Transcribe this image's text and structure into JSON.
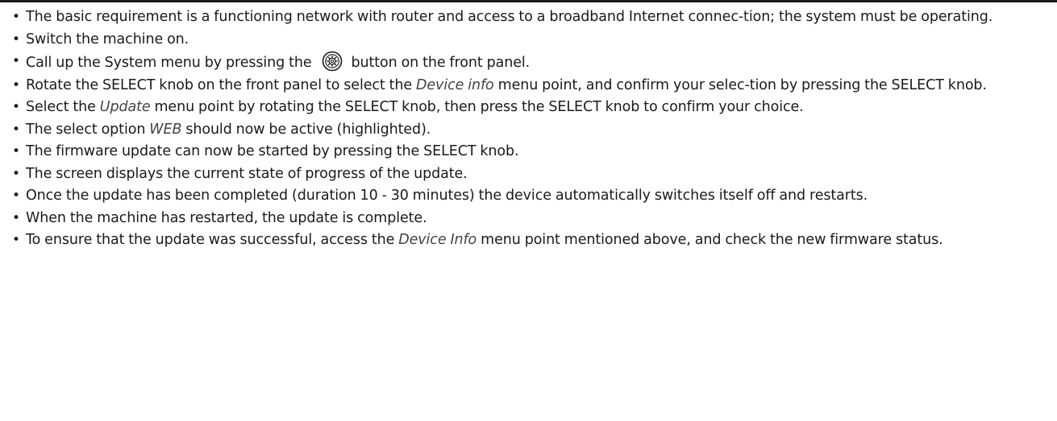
{
  "instructions": {
    "items": [
      {
        "text": "The basic requirement is a functioning network with router and access to a broadband Internet connec-tion; the system must be operating."
      },
      {
        "text": "Switch the machine on."
      },
      {
        "before": "Call up the System menu by pressing the",
        "icon": "system-menu-button-icon",
        "after": "button on the front panel."
      },
      {
        "before": "Rotate the SELECT knob on the front panel to select the ",
        "term": "Device info",
        "after": " menu point, and confirm your selec-tion by pressing the SELECT knob."
      },
      {
        "before": "Select the ",
        "term": "Update",
        "after": " menu point by rotating the SELECT knob, then press the SELECT knob to confirm your choice."
      },
      {
        "before": "The select option ",
        "term": "WEB",
        "after": " should now be active (highlighted)."
      },
      {
        "text": "The firmware update can now be started by pressing the SELECT knob."
      },
      {
        "text": "The screen displays the current state of progress of the update."
      },
      {
        "text": "Once the update has been completed (duration 10 - 30 minutes) the device automatically switches itself off and restarts."
      },
      {
        "text": "When the machine has restarted, the update is complete."
      },
      {
        "before": "To ensure that the update was successful, access the ",
        "term": "Device Info",
        "after": " menu point mentioned above, and check the new firmware status."
      }
    ]
  }
}
